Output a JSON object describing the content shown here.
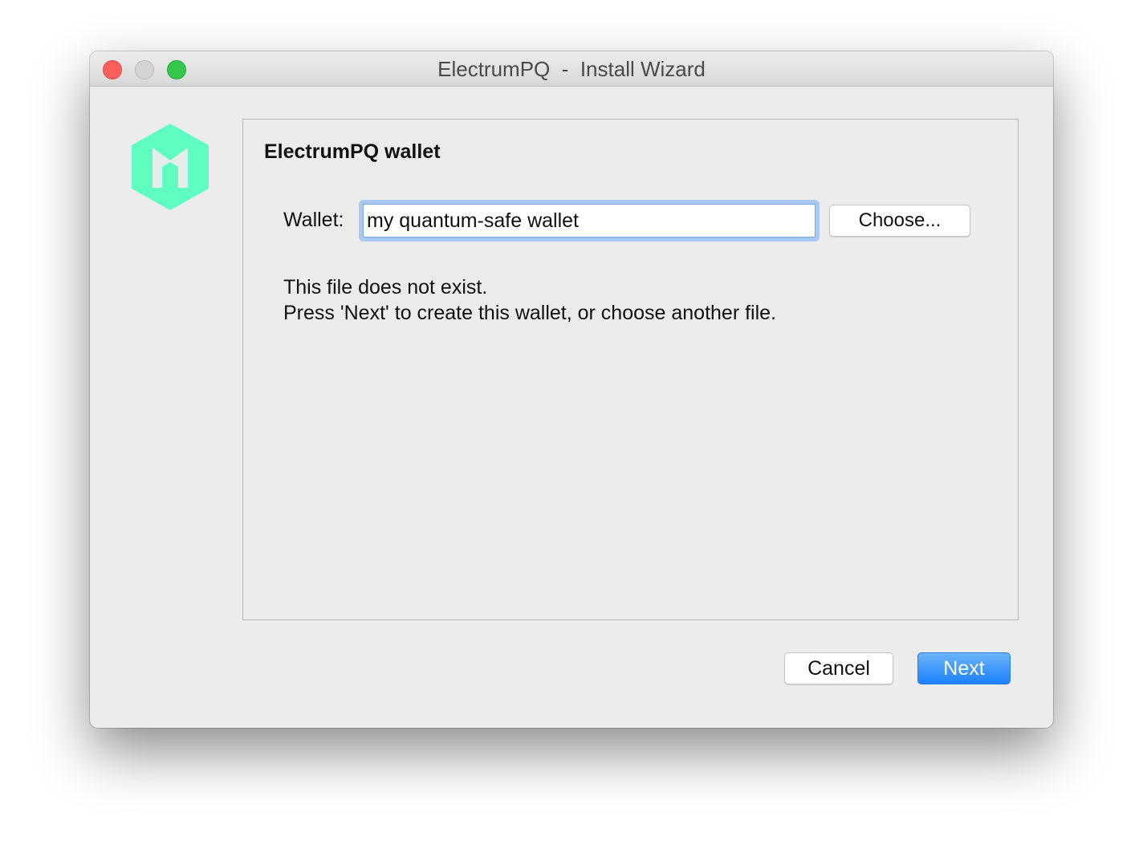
{
  "window": {
    "title": "ElectrumPQ  -  Install Wizard"
  },
  "logo": {
    "icon": "electrumpq-hexagon-logo",
    "color": "#5effc0"
  },
  "panel": {
    "title": "ElectrumPQ wallet",
    "wallet_label": "Wallet:",
    "wallet_value": "my quantum-safe wallet",
    "choose_label": "Choose...",
    "message_line1": "This file does not exist.",
    "message_line2": "Press 'Next' to create this wallet, or choose another file."
  },
  "buttons": {
    "cancel_label": "Cancel",
    "next_label": "Next"
  },
  "colors": {
    "accent": "#1a82fb",
    "focus_ring": "#a7c9f3",
    "close": "#fc605b",
    "minimize_disabled": "#d3d3d3",
    "maximize": "#34c84a"
  }
}
